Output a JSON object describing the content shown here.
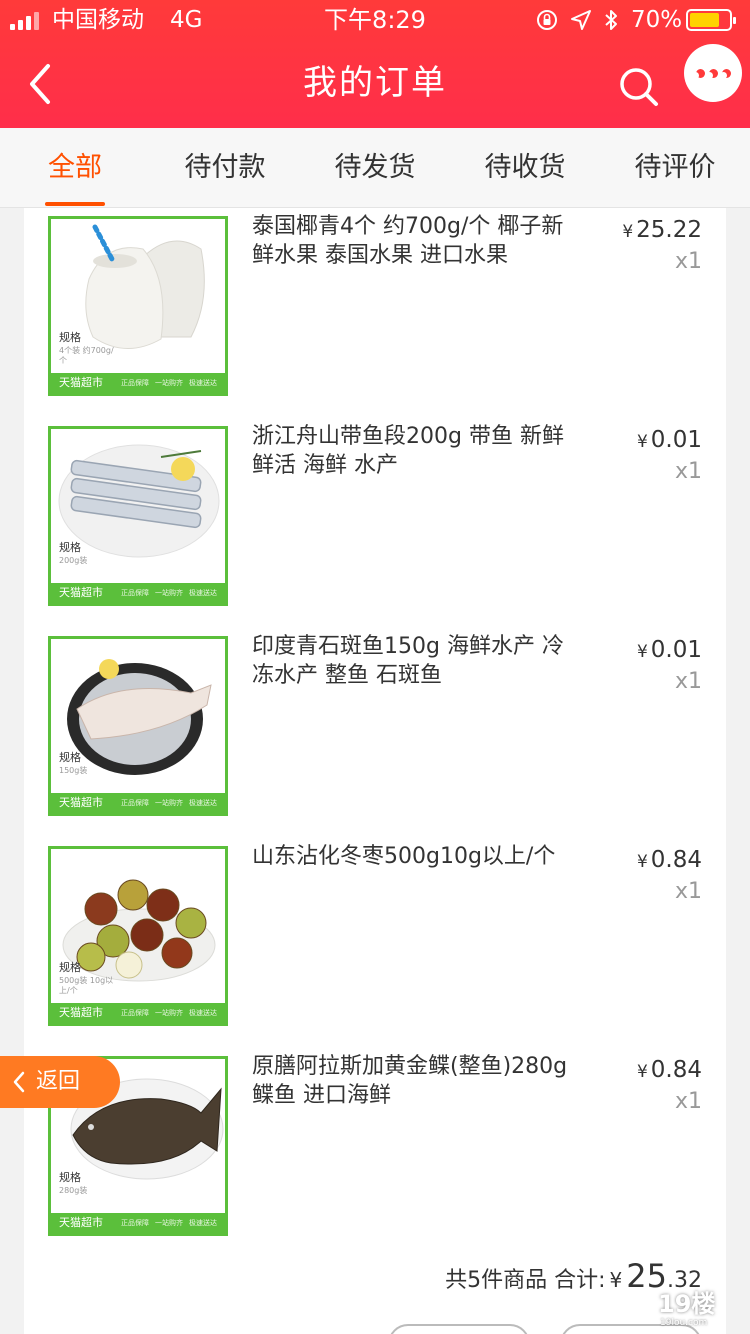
{
  "status_bar": {
    "carrier": "中国移动",
    "network": "4G",
    "time": "下午8:29",
    "battery_percent": "70%",
    "battery_level": 0.7,
    "icons": [
      "orientation-lock-icon",
      "location-arrow-icon",
      "bluetooth-icon"
    ]
  },
  "nav": {
    "title": "我的订单",
    "back_icon": "chevron-left-icon",
    "search_icon": "search-icon",
    "more_icon": "more-dots-icon"
  },
  "tabs": [
    {
      "label": "全部",
      "active": true
    },
    {
      "label": "待付款",
      "active": false
    },
    {
      "label": "待发货",
      "active": false
    },
    {
      "label": "待收货",
      "active": false
    },
    {
      "label": "待评价",
      "active": false
    }
  ],
  "order": {
    "items": [
      {
        "title": "泰国椰青4个 约700g/个 椰子新鲜水果 泰国水果 进口水果",
        "currency": "¥",
        "price": "25.22",
        "quantity": "x1",
        "image": "coconut-image",
        "thumb": {
          "spec_label": "规格",
          "spec_text": "4个装 约700g/个",
          "brand": "天猫超市"
        }
      },
      {
        "title": "浙江舟山带鱼段200g 带鱼 新鲜 鲜活 海鲜 水产",
        "currency": "¥",
        "price": "0.01",
        "quantity": "x1",
        "image": "hairtail-fish-image",
        "thumb": {
          "spec_label": "规格",
          "spec_text": "200g装",
          "brand": "天猫超市"
        }
      },
      {
        "title": "印度青石斑鱼150g 海鲜水产 冷冻水产 整鱼 石斑鱼",
        "currency": "¥",
        "price": "0.01",
        "quantity": "x1",
        "image": "grouper-fish-image",
        "thumb": {
          "spec_label": "规格",
          "spec_text": "150g装",
          "brand": "天猫超市"
        }
      },
      {
        "title": "山东沾化冬枣500g10g以上/个",
        "currency": "¥",
        "price": "0.84",
        "quantity": "x1",
        "image": "jujube-image",
        "thumb": {
          "spec_label": "规格",
          "spec_text": "500g装 10g以上/个",
          "brand": "天猫超市"
        }
      },
      {
        "title": "原膳阿拉斯加黄金鲽(整鱼)280g  鲽鱼 进口海鲜",
        "currency": "¥",
        "price": "0.84",
        "quantity": "x1",
        "image": "flounder-fish-image",
        "thumb": {
          "spec_label": "规格",
          "spec_text": "280g装",
          "brand": "天猫超市"
        }
      }
    ],
    "thumb_bar_notes": [
      "正品保障",
      "一站购齐",
      "极速送达"
    ],
    "summary": {
      "count_text": "共5件商品",
      "total_label": "合计:",
      "currency": "¥",
      "total_int": "25",
      "total_dec": ".32"
    }
  },
  "float_back": {
    "label": "返回",
    "icon": "chevron-left-icon"
  },
  "watermark": {
    "number": "19楼",
    "site": "19lou.com"
  },
  "colors": {
    "header_red": "#ff3a3a",
    "tab_active": "#ff5000",
    "thumb_green": "#5bbf3b",
    "float_back_orange": "#ff7a22",
    "battery_yellow": "#ffd200"
  }
}
